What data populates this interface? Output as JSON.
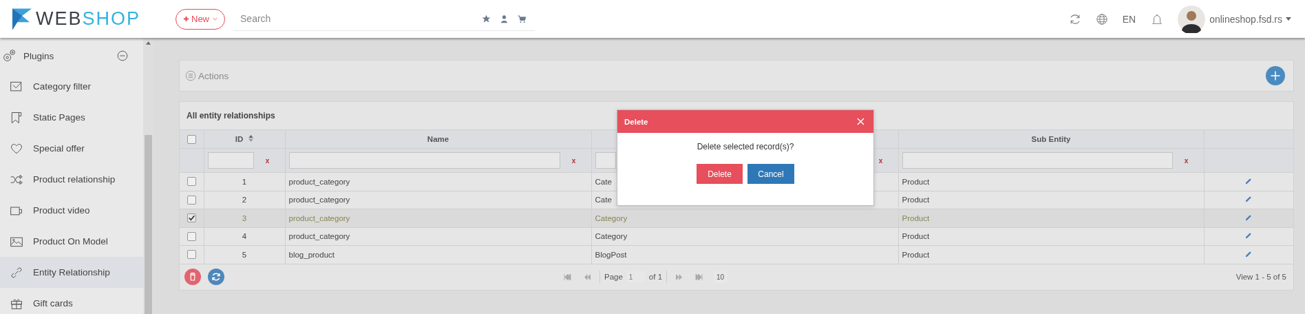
{
  "header": {
    "logo": {
      "text": "WEB",
      "accent": "SHOP"
    },
    "new_button": "New",
    "search": {
      "placeholder": "Search"
    },
    "language": "EN",
    "user": "onlineshop.fsd.rs"
  },
  "sidebar": {
    "section": {
      "label": "Plugins",
      "expanded": true
    },
    "items": [
      {
        "label": "Category filter",
        "selected": false
      },
      {
        "label": "Static Pages",
        "selected": false
      },
      {
        "label": "Special offer",
        "selected": false
      },
      {
        "label": "Product relationship",
        "selected": false
      },
      {
        "label": "Product video",
        "selected": false
      },
      {
        "label": "Product On Model",
        "selected": false
      },
      {
        "label": "Entity Relationship",
        "selected": true
      },
      {
        "label": "Gift cards",
        "selected": false
      }
    ]
  },
  "actions_panel": {
    "title": "Actions"
  },
  "table": {
    "title": "All entity relationships",
    "all_selected": false,
    "columns": {
      "id": "ID",
      "name": "Name",
      "sub_entity": "Sub Entity"
    },
    "filter_clear": [
      "x",
      "x",
      "x",
      "x"
    ],
    "rows": [
      {
        "selected": false,
        "id": "1",
        "name": "product_category",
        "column_3": "Cate",
        "sub_entity": "Product"
      },
      {
        "selected": false,
        "id": "2",
        "name": "product_category",
        "column_3": "Cate",
        "sub_entity": "Product"
      },
      {
        "selected": true,
        "id": "3",
        "name": "product_category",
        "column_3": "Category",
        "sub_entity": "Product"
      },
      {
        "selected": false,
        "id": "4",
        "name": "product_category",
        "column_3": "Category",
        "sub_entity": "Product"
      },
      {
        "selected": false,
        "id": "5",
        "name": "blog_product",
        "column_3": "BlogPost",
        "sub_entity": "Product"
      }
    ],
    "pager": {
      "page_label": "Page",
      "page": "1",
      "of": "of 1",
      "page_size": "10",
      "view": "View 1 - 5 of 5"
    }
  },
  "modal": {
    "title": "Delete",
    "message": "Delete selected record(s)?",
    "buttons": [
      {
        "label": "Delete",
        "kind": "danger"
      },
      {
        "label": "Cancel",
        "kind": "primary"
      }
    ]
  }
}
